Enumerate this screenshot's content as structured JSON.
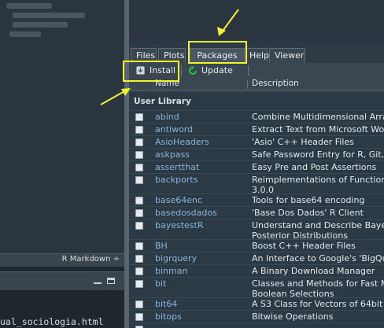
{
  "editor": {
    "mode_label": "R Markdown ÷"
  },
  "console": {
    "line": "ual_sociologia.html"
  },
  "tabs": [
    {
      "label": "Files"
    },
    {
      "label": "Plots"
    },
    {
      "label": "Packages"
    },
    {
      "label": "Help"
    },
    {
      "label": "Viewer"
    }
  ],
  "toolbar": {
    "install_label": "Install",
    "update_label": "Update"
  },
  "columns": {
    "name": "Name",
    "description": "Description"
  },
  "library_header": "User Library",
  "packages": [
    {
      "name": "abind",
      "desc": [
        "Combine Multidimensional Arra"
      ]
    },
    {
      "name": "antiword",
      "desc": [
        "Extract Text from Microsoft Wor"
      ]
    },
    {
      "name": "AsioHeaders",
      "desc": [
        "'Asio' C++ Header Files"
      ]
    },
    {
      "name": "askpass",
      "desc": [
        "Safe Password Entry for R, Git,"
      ]
    },
    {
      "name": "assertthat",
      "desc": [
        "Easy Pre and Post Assertions"
      ]
    },
    {
      "name": "backports",
      "desc": [
        "Reimplementations of Function",
        "3.0.0"
      ]
    },
    {
      "name": "base64enc",
      "desc": [
        "Tools for base64 encoding"
      ]
    },
    {
      "name": "basedosdados",
      "desc": [
        "'Base Dos Dados' R Client"
      ]
    },
    {
      "name": "bayestestR",
      "desc": [
        "Understand and Describe Baye",
        "Posterior Distributions"
      ]
    },
    {
      "name": "BH",
      "desc": [
        "Boost C++ Header Files"
      ]
    },
    {
      "name": "bigrquery",
      "desc": [
        "An Interface to Google's 'BigQu"
      ]
    },
    {
      "name": "binman",
      "desc": [
        "A Binary Download Manager"
      ]
    },
    {
      "name": "bit",
      "desc": [
        "Classes and Methods for Fast M",
        "Boolean Selections"
      ]
    },
    {
      "name": "bit64",
      "desc": [
        "A S3 Class for Vectors of 64bit I"
      ]
    },
    {
      "name": "bitops",
      "desc": [
        "Bitwise Operations"
      ]
    },
    {
      "name": "",
      "desc": [
        ""
      ]
    }
  ],
  "colors": {
    "highlight": "#f2f22e",
    "link": "#8ab4d8",
    "update_icon": "#27c93f"
  },
  "icons": [
    "install-icon",
    "update-icon",
    "minimize-icon",
    "maximize-icon",
    "checkbox-icon"
  ]
}
